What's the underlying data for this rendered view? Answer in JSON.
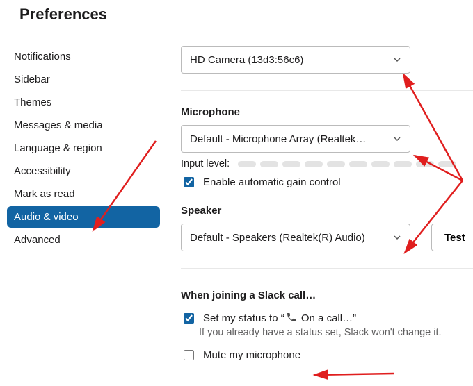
{
  "title": "Preferences",
  "sidebar": {
    "items": [
      {
        "label": "Notifications"
      },
      {
        "label": "Sidebar"
      },
      {
        "label": "Themes"
      },
      {
        "label": "Messages & media"
      },
      {
        "label": "Language & region"
      },
      {
        "label": "Accessibility"
      },
      {
        "label": "Mark as read"
      },
      {
        "label": "Audio & video"
      },
      {
        "label": "Advanced"
      }
    ],
    "activeIndex": 7
  },
  "camera": {
    "selected": "HD Camera (13d3:56c6)"
  },
  "microphone": {
    "heading": "Microphone",
    "selected": "Default - Microphone Array (Realtek…",
    "inputLevelLabel": "Input level:",
    "gainControl": {
      "checked": true,
      "label": "Enable automatic gain control"
    }
  },
  "speaker": {
    "heading": "Speaker",
    "selected": "Default - Speakers (Realtek(R) Audio)",
    "testLabel": "Test"
  },
  "joining": {
    "heading": "When joining a Slack call…",
    "setStatus": {
      "checked": true,
      "prefix": "Set my status to “",
      "statusText": " On a call…",
      "suffix": "”",
      "note": "If you already have a status set, Slack won't change it."
    },
    "muteMic": {
      "checked": false,
      "label": "Mute my microphone"
    }
  }
}
